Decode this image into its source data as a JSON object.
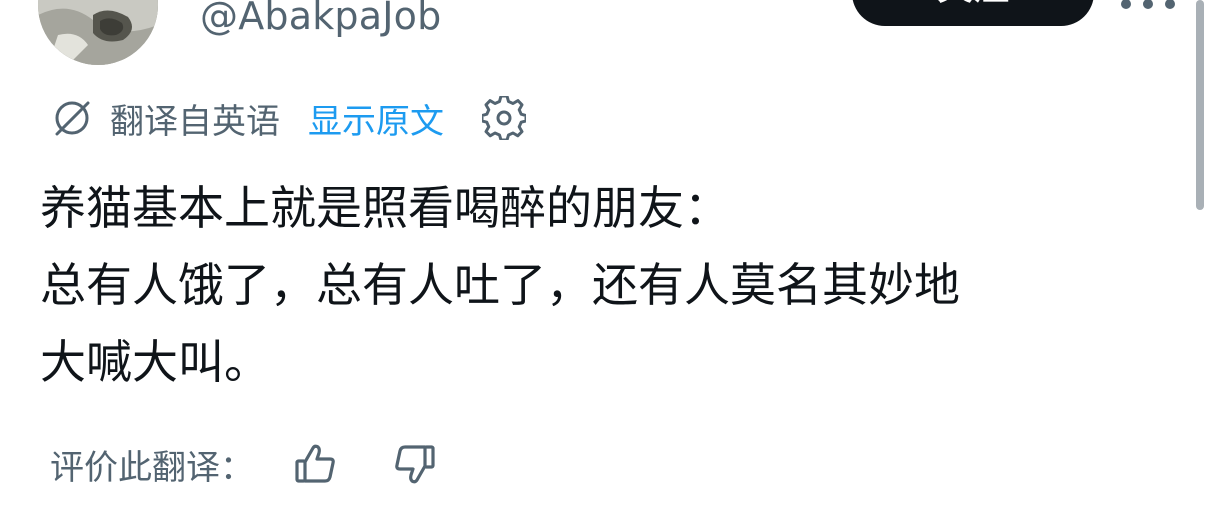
{
  "profile": {
    "handle": "@AbakpaJob",
    "avatar_icon": "avatar-photo",
    "follow_label": "关注"
  },
  "translation": {
    "icon": "globe-icon",
    "translated_from": "翻译自英语",
    "show_original": "显示原文",
    "settings_icon": "gear-icon"
  },
  "tweet": {
    "lines": [
      "养猫基本上就是照看喝醉的朋友：",
      "总有人饿了，总有人吐了，还有人莫名其妙地",
      "大喊大叫。"
    ]
  },
  "rating": {
    "label": "评价此翻译：",
    "up_icon": "thumbs-up-icon",
    "down_icon": "thumbs-down-icon"
  },
  "colors": {
    "text": "#0f1419",
    "secondary": "#536471",
    "link": "#1d9bf0",
    "button": "#0f1419"
  }
}
